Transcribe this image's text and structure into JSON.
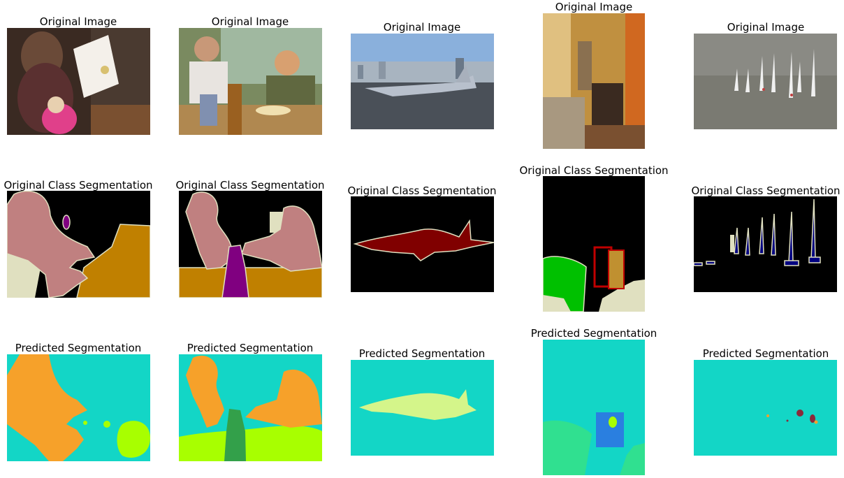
{
  "figure": {
    "row_titles": [
      "Original Image",
      "Original Class Segmentation",
      "Predicted Segmentation"
    ]
  },
  "colors": {
    "black": "#000000",
    "person": "#c08080",
    "table": "#c08000",
    "bottle": "#800080",
    "chair": "#c00000",
    "aeroplane": "#800000",
    "boat": "#000080",
    "void_outline": "#e0e0c0",
    "beige": "#e0e0c0",
    "green": "#00c000",
    "pred_background": "#13d6c6",
    "pred_person": "#f6a12a",
    "pred_table": "#a8ff00",
    "pred_bottle": "#33a04a",
    "pred_plane": "#d4f58a",
    "pred_blue": "#2a7fe0",
    "pred_green": "#30e090",
    "pred_maroon": "#8a2a3a"
  },
  "chart_data": [
    {
      "type": "image",
      "title": "Original Image",
      "content": "woman reading a book to a child"
    },
    {
      "type": "image",
      "title": "Original Image",
      "content": "two people at a restaurant table"
    },
    {
      "type": "image",
      "title": "Original Image",
      "content": "fighter jet on an aircraft carrier deck"
    },
    {
      "type": "image",
      "title": "Original Image",
      "content": "living room with chairs"
    },
    {
      "type": "image",
      "title": "Original Image",
      "content": "sailboats on water"
    },
    {
      "type": "segmentation",
      "title": "Original Class Segmentation",
      "classes": [
        "person",
        "bottle",
        "dining table"
      ]
    },
    {
      "type": "segmentation",
      "title": "Original Class Segmentation",
      "classes": [
        "person",
        "bottle",
        "dining table"
      ]
    },
    {
      "type": "segmentation",
      "title": "Original Class Segmentation",
      "classes": [
        "aeroplane"
      ]
    },
    {
      "type": "segmentation",
      "title": "Original Class Segmentation",
      "classes": [
        "chair",
        "sofa",
        "pottedplant"
      ]
    },
    {
      "type": "segmentation",
      "title": "Original Class Segmentation",
      "classes": [
        "boat"
      ]
    },
    {
      "type": "segmentation",
      "title": "Predicted Segmentation"
    },
    {
      "type": "segmentation",
      "title": "Predicted Segmentation"
    },
    {
      "type": "segmentation",
      "title": "Predicted Segmentation"
    },
    {
      "type": "segmentation",
      "title": "Predicted Segmentation"
    },
    {
      "type": "segmentation",
      "title": "Predicted Segmentation"
    }
  ]
}
